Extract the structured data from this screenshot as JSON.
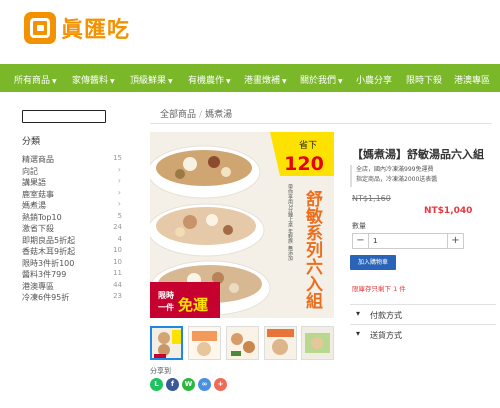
{
  "brand": {
    "name": "眞匯吃"
  },
  "nav": [
    {
      "label": "所有商品",
      "dropdown": true
    },
    {
      "label": "家傳醬料",
      "dropdown": true
    },
    {
      "label": "頂級鮮果",
      "dropdown": true
    },
    {
      "label": "有機農作",
      "dropdown": true
    },
    {
      "label": "港畫燉補",
      "dropdown": true
    },
    {
      "label": "關於我們",
      "dropdown": true
    },
    {
      "label": "小農分享",
      "dropdown": false
    },
    {
      "label": "限時下殺",
      "dropdown": false
    },
    {
      "label": "港澳專區",
      "dropdown": false
    }
  ],
  "sidebar": {
    "search_value": "",
    "title": "分類",
    "items": [
      {
        "label": "精選商品",
        "count": "15"
      },
      {
        "label": "向記",
        "count": ""
      },
      {
        "label": "講果語",
        "count": ""
      },
      {
        "label": "鹿室菇事",
        "count": ""
      },
      {
        "label": "媽煮湯",
        "count": ""
      },
      {
        "label": "熱銷Top10",
        "count": "5"
      },
      {
        "label": "激省下殺",
        "count": "24"
      },
      {
        "label": "即期良品5折起",
        "count": "4"
      },
      {
        "label": "香菇木耳9折起",
        "count": "10"
      },
      {
        "label": "限時3件折100",
        "count": "10"
      },
      {
        "label": "醬料3件799",
        "count": "11"
      },
      {
        "label": "港澳專區",
        "count": "44"
      },
      {
        "label": "冷凍6件95折",
        "count": "23"
      }
    ]
  },
  "breadcrumb": [
    "全部商品",
    "媽煮湯"
  ],
  "product": {
    "title": "【媽煮湯】舒敏湯品六入組",
    "desc_lines": [
      "全店，國內冷凍滿999免運費",
      "指定商品，冷凍滿2000送表醬"
    ],
    "old_price": "NT$1,160",
    "new_price": "NT$1,040",
    "qty_label": "數量",
    "qty_minus": "−",
    "qty_value": "1",
    "qty_plus": "+",
    "cart_label": "加入購物車",
    "stock": "限庫存只剩下 1 件",
    "accordion": [
      "付款方式",
      "送貨方式"
    ]
  },
  "banner": {
    "save_label": "省下",
    "save_amount": "120",
    "headline": "舒敏系列六入組",
    "side_note": "帶你享用3分鐘上桌 年輕族 無添加",
    "corner_top": "限時",
    "corner_mid": "一件",
    "corner_big": "免運"
  },
  "share": {
    "label": "分享到",
    "buttons": [
      {
        "icon": "line-icon",
        "color": "#1dc35f",
        "glyph": "L"
      },
      {
        "icon": "facebook-icon",
        "color": "#3b5998",
        "glyph": "f"
      },
      {
        "icon": "whatsapp-icon",
        "color": "#2cb742",
        "glyph": "W"
      },
      {
        "icon": "link-icon",
        "color": "#4a90e2",
        "glyph": "∞"
      },
      {
        "icon": "plus-icon",
        "color": "#f06b57",
        "glyph": "+"
      }
    ]
  },
  "colors": {
    "nav": "#7ab829",
    "brand": "#f39200",
    "price": "#e8373e",
    "cart": "#2a64b8"
  }
}
